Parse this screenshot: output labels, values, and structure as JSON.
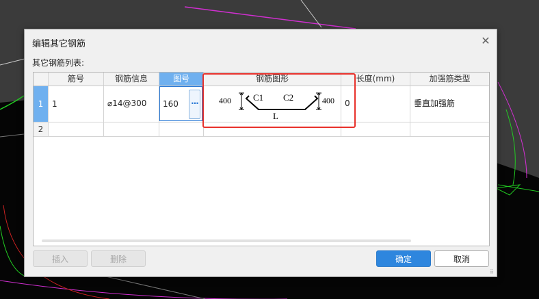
{
  "dialog": {
    "title": "编辑其它钢筋",
    "close_glyph": "✕",
    "list_label": "其它钢筋列表:"
  },
  "table": {
    "headers": [
      "筋号",
      "钢筋信息",
      "图号",
      "钢筋图形",
      "长度(mm)",
      "加强筋类型"
    ],
    "rows": [
      {
        "num": "1",
        "bar_no": "1",
        "info": "⌀14@300",
        "figure_no": "160",
        "length": "0",
        "type": "垂直加强筋",
        "shape": {
          "left_height": "400",
          "c1": "C1",
          "c2": "C2",
          "right_height": "400",
          "base": "L"
        }
      },
      {
        "num": "2",
        "bar_no": "",
        "info": "",
        "figure_no": "",
        "length": "",
        "type": ""
      }
    ],
    "edit_button": "···"
  },
  "buttons": {
    "insert": "插入",
    "delete": "删除",
    "ok": "确定",
    "cancel": "取消"
  },
  "colors": {
    "accent": "#2e86de",
    "selected_header": "#6fb0ef",
    "highlight": "#e8312b"
  }
}
